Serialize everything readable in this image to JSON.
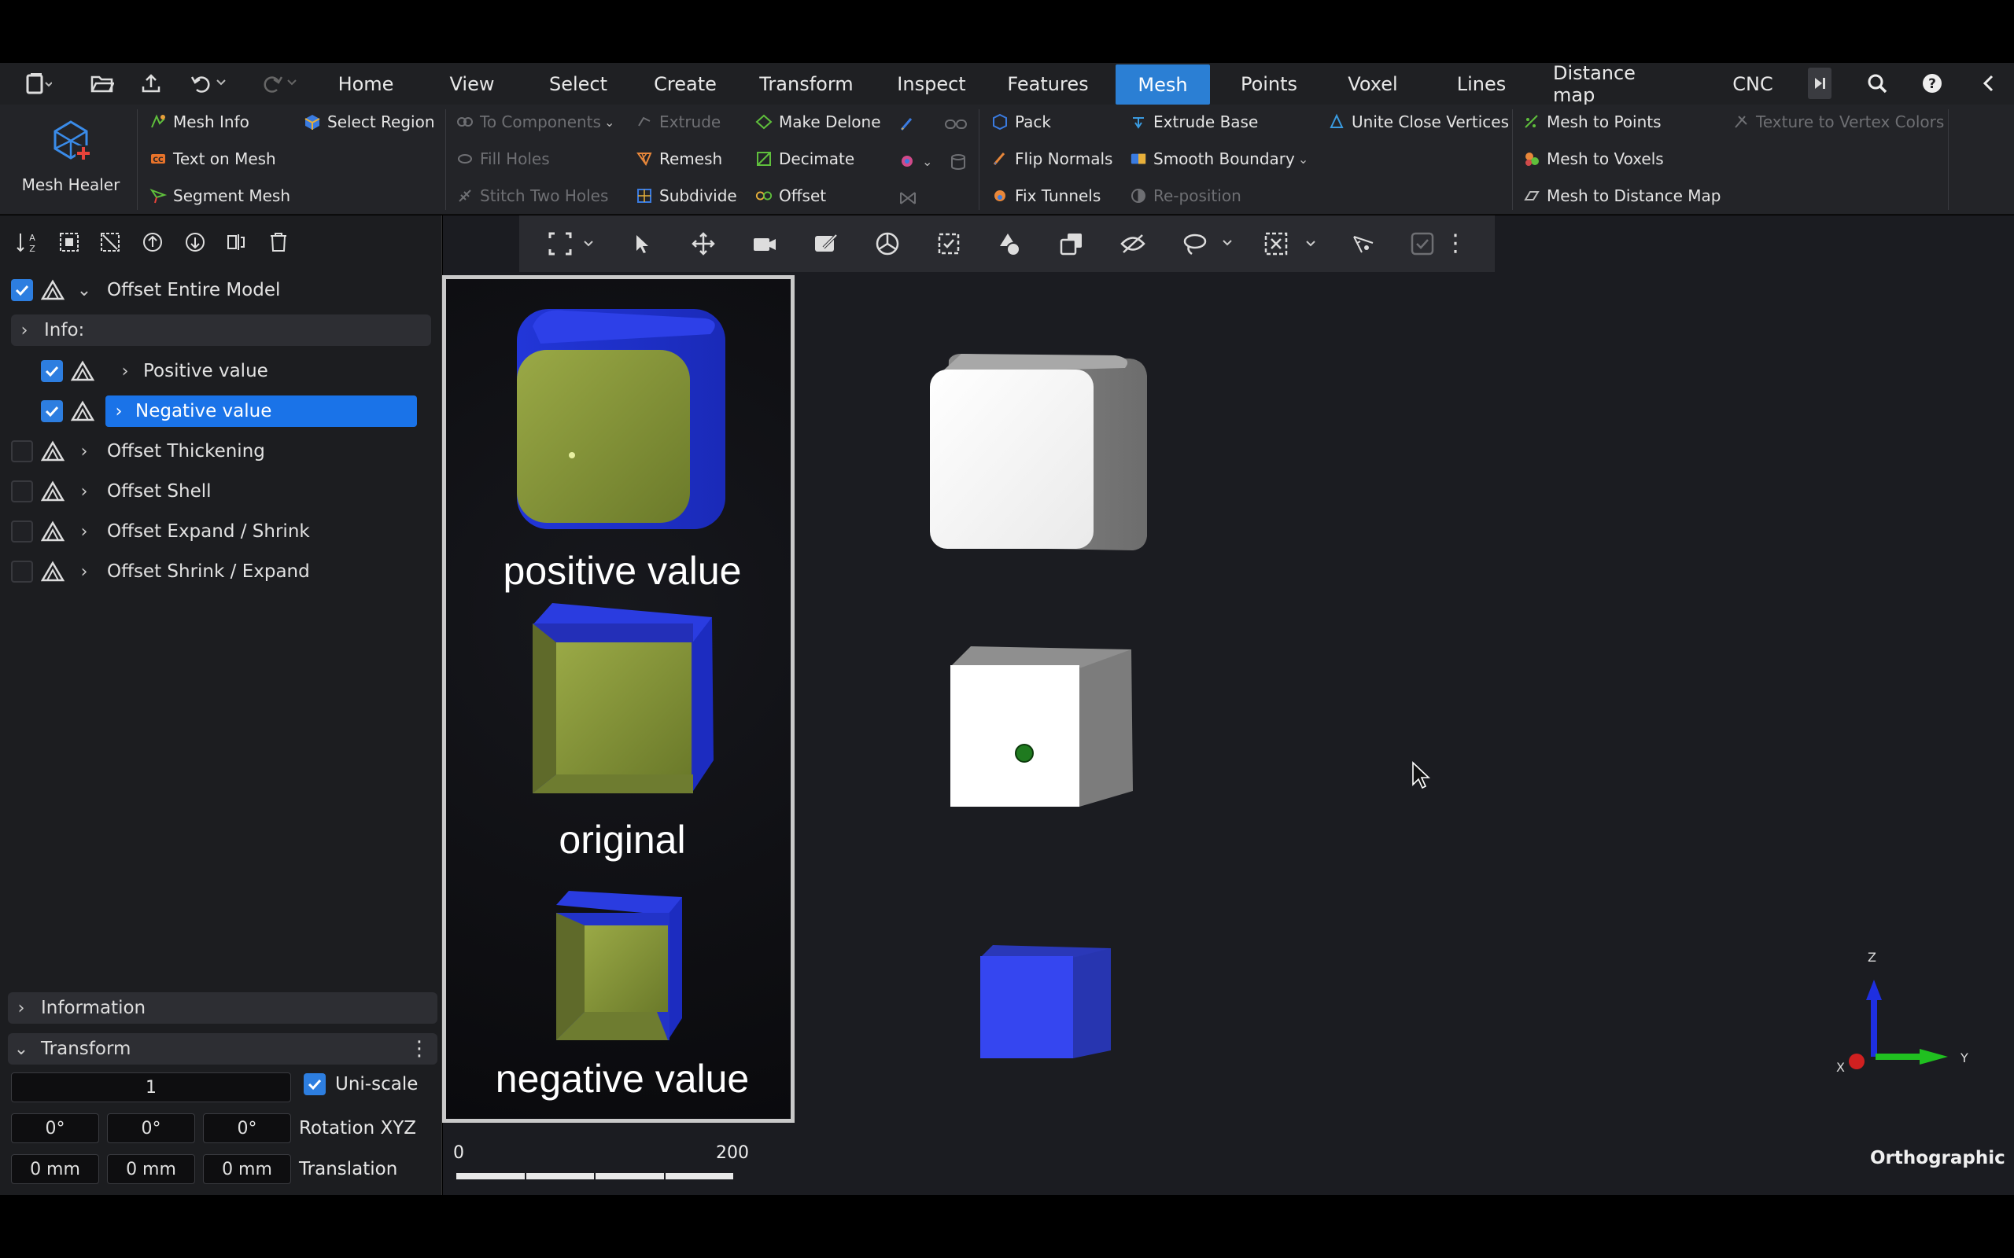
{
  "menubar": {
    "tabs": [
      {
        "label": "Home"
      },
      {
        "label": "View"
      },
      {
        "label": "Select"
      },
      {
        "label": "Create"
      },
      {
        "label": "Transform"
      },
      {
        "label": "Inspect"
      },
      {
        "label": "Features"
      },
      {
        "label": "Mesh",
        "active": true
      },
      {
        "label": "Points"
      },
      {
        "label": "Voxel"
      },
      {
        "label": "Lines"
      },
      {
        "label": "Distance map"
      },
      {
        "label": "CNC"
      }
    ],
    "icons": [
      "document-icon",
      "folder-open-icon",
      "upload-icon",
      "undo-icon",
      "redo-icon",
      "skip-icon",
      "search-icon",
      "help-icon",
      "collapse-icon"
    ]
  },
  "ribbon": {
    "mesh_healer": "Mesh Healer",
    "mesh_info": "Mesh Info",
    "select_region": "Select Region",
    "text_on_mesh": "Text on Mesh",
    "segment_mesh": "Segment Mesh",
    "to_components": "To Components",
    "fill_holes": "Fill Holes",
    "stitch_two_holes": "Stitch Two Holes",
    "extrude": "Extrude",
    "remesh": "Remesh",
    "subdivide": "Subdivide",
    "make_delone": "Make Delone",
    "decimate": "Decimate",
    "offset": "Offset",
    "pack": "Pack",
    "flip_normals": "Flip Normals",
    "fix_tunnels": "Fix Tunnels",
    "extrude_base": "Extrude Base",
    "smooth_boundary": "Smooth Boundary",
    "reposition": "Re-position",
    "unite_close_vertices": "Unite Close Vertices",
    "mesh_to_points": "Mesh to Points",
    "mesh_to_voxels": "Mesh to Voxels",
    "mesh_to_distance_map": "Mesh to Distance Map",
    "texture_to_vertex_colors": "Texture to Vertex Colors"
  },
  "scene_tree": {
    "root": "Offset Entire Model",
    "info_label": "Info:",
    "children": [
      "Positive value",
      "Negative value"
    ],
    "items": [
      "Offset Thickening",
      "Offset Shell",
      "Offset Expand / Shrink",
      "Offset Shrink / Expand"
    ]
  },
  "panels": {
    "information": "Information",
    "transform": "Transform"
  },
  "transform": {
    "scale": "1",
    "uniscale_label": "Uni-scale",
    "rot_x": "0°",
    "rot_y": "0°",
    "rot_z": "0°",
    "rotation_label": "Rotation XYZ",
    "tr_x": "0 mm",
    "tr_y": "0 mm",
    "tr_z": "0 mm",
    "translation_label": "Translation"
  },
  "legend": {
    "positive": "positive value",
    "original": "original",
    "negative": "negative value"
  },
  "scale_bar": {
    "start": "0",
    "end": "200"
  },
  "axes": {
    "z": "Z",
    "y": "Y",
    "x": "X"
  },
  "viewport": {
    "projection": "Orthographic"
  },
  "colors": {
    "accent": "#2b7fd4",
    "selection": "#1a73e8",
    "cube_blue": "#2f43e0",
    "cube_yellow": "#8a9a3a"
  }
}
